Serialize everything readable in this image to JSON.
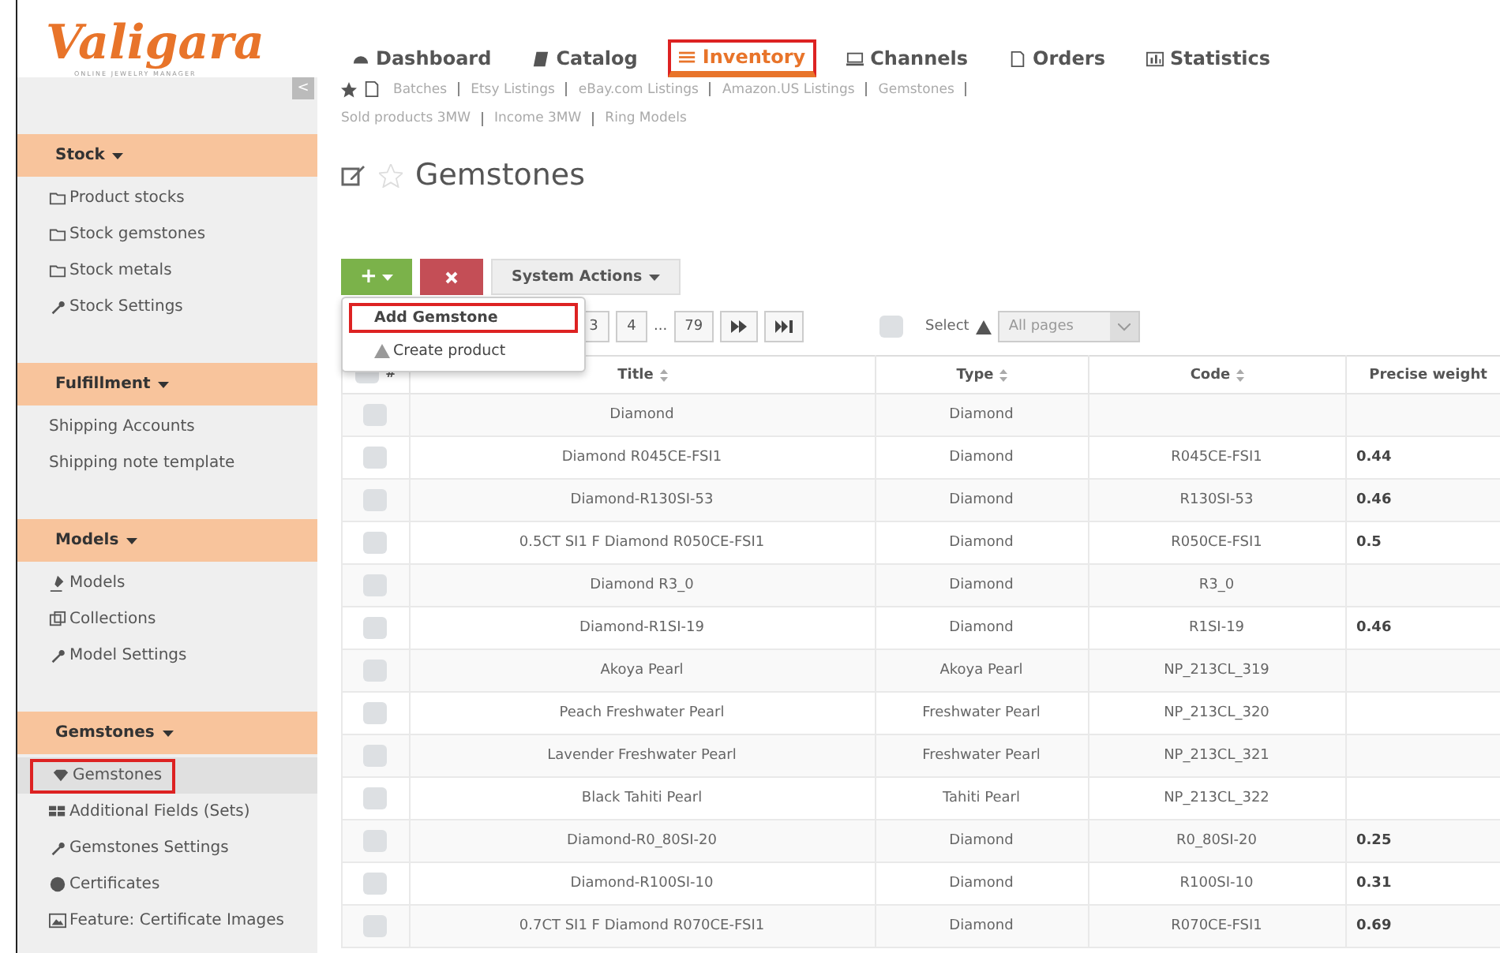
{
  "logo": {
    "name": "Valigara",
    "tagline": "ONLINE JEWELRY MANAGER"
  },
  "nav": [
    {
      "label": "Dashboard",
      "kind": "dashboard",
      "selected": false
    },
    {
      "label": "Catalog",
      "kind": "book",
      "selected": false
    },
    {
      "label": "Inventory",
      "kind": "list",
      "selected": true
    },
    {
      "label": "Channels",
      "kind": "monitor",
      "selected": false
    },
    {
      "label": "Orders",
      "kind": "file",
      "selected": false
    },
    {
      "label": "Statistics",
      "kind": "chart",
      "selected": false
    }
  ],
  "subnav": [
    "Batches",
    "Etsy Listings",
    "eBay.com Listings",
    "Amazon.US Listings",
    "Gemstones",
    "Sold products 3MW",
    "Income 3MW",
    "Ring Models"
  ],
  "collapse_button": "<",
  "sidebar": [
    {
      "title": "Stock",
      "items": [
        {
          "label": "Product stocks",
          "kind": "folder",
          "selected": false
        },
        {
          "label": "Stock gemstones",
          "kind": "folder",
          "selected": false
        },
        {
          "label": "Stock metals",
          "kind": "folder",
          "selected": false
        },
        {
          "label": "Stock Settings",
          "kind": "wrench",
          "selected": false
        }
      ]
    },
    {
      "title": "Fulfillment",
      "items": [
        {
          "label": "Shipping Accounts",
          "kind": "plain",
          "selected": false
        },
        {
          "label": "Shipping note template",
          "kind": "plain",
          "selected": false
        }
      ]
    },
    {
      "title": "Models",
      "items": [
        {
          "label": "Models",
          "kind": "pin",
          "selected": false
        },
        {
          "label": "Collections",
          "kind": "copy",
          "selected": false
        },
        {
          "label": "Model Settings",
          "kind": "wrench",
          "selected": false
        }
      ]
    },
    {
      "title": "Gemstones",
      "items": [
        {
          "label": "Gemstones",
          "kind": "gem",
          "selected": true
        },
        {
          "label": "Additional Fields (Sets)",
          "kind": "grid",
          "selected": false
        },
        {
          "label": "Gemstones Settings",
          "kind": "wrench",
          "selected": false
        },
        {
          "label": "Certificates",
          "kind": "cert",
          "selected": false
        },
        {
          "label": "Feature: Certificate Images",
          "kind": "image",
          "selected": false
        }
      ]
    }
  ],
  "page_title": "Gemstones",
  "toolbar": {
    "add": "+",
    "system_actions": "System Actions"
  },
  "add_menu": [
    {
      "label": "Add Gemstone",
      "selected": true
    },
    {
      "label": "Create product",
      "selected": false
    }
  ],
  "pagination": [
    "3",
    "4",
    "...",
    "79"
  ],
  "select": {
    "label": "Select",
    "value": "All pages",
    "checked": false
  },
  "table": {
    "select_all": {
      "label": "#",
      "checked": false
    },
    "columns": [
      "Title",
      "Type",
      "Code",
      "Precise weight"
    ],
    "rows": [
      {
        "checked": false,
        "cells": [
          "Diamond",
          "Diamond",
          "",
          ""
        ]
      },
      {
        "checked": false,
        "cells": [
          "Diamond R045CE-FSI1",
          "Diamond",
          "R045CE-FSI1",
          "0.44"
        ]
      },
      {
        "checked": false,
        "cells": [
          "Diamond-R130SI-53",
          "Diamond",
          "R130SI-53",
          "0.46"
        ]
      },
      {
        "checked": false,
        "cells": [
          "0.5CT SI1 F Diamond R050CE-FSI1",
          "Diamond",
          "R050CE-FSI1",
          "0.5"
        ]
      },
      {
        "checked": false,
        "cells": [
          "Diamond R3_0",
          "Diamond",
          "R3_0",
          ""
        ]
      },
      {
        "checked": false,
        "cells": [
          "Diamond-R1SI-19",
          "Diamond",
          "R1SI-19",
          "0.46"
        ]
      },
      {
        "checked": false,
        "cells": [
          "Akoya Pearl",
          "Akoya Pearl",
          "NP_213CL_319",
          ""
        ]
      },
      {
        "checked": false,
        "cells": [
          "Peach Freshwater Pearl",
          "Freshwater Pearl",
          "NP_213CL_320",
          ""
        ]
      },
      {
        "checked": false,
        "cells": [
          "Lavender Freshwater Pearl",
          "Freshwater Pearl",
          "NP_213CL_321",
          ""
        ]
      },
      {
        "checked": false,
        "cells": [
          "Black Tahiti Pearl",
          "Tahiti Pearl",
          "NP_213CL_322",
          ""
        ]
      },
      {
        "checked": false,
        "cells": [
          "Diamond-R0_80SI-20",
          "Diamond",
          "R0_80SI-20",
          "0.25"
        ]
      },
      {
        "checked": false,
        "cells": [
          "Diamond-R100SI-10",
          "Diamond",
          "R100SI-10",
          "0.31"
        ]
      },
      {
        "checked": false,
        "cells": [
          "0.7CT SI1 F Diamond R070CE-FSI1",
          "Diamond",
          "R070CE-FSI1",
          "0.69"
        ]
      }
    ]
  }
}
